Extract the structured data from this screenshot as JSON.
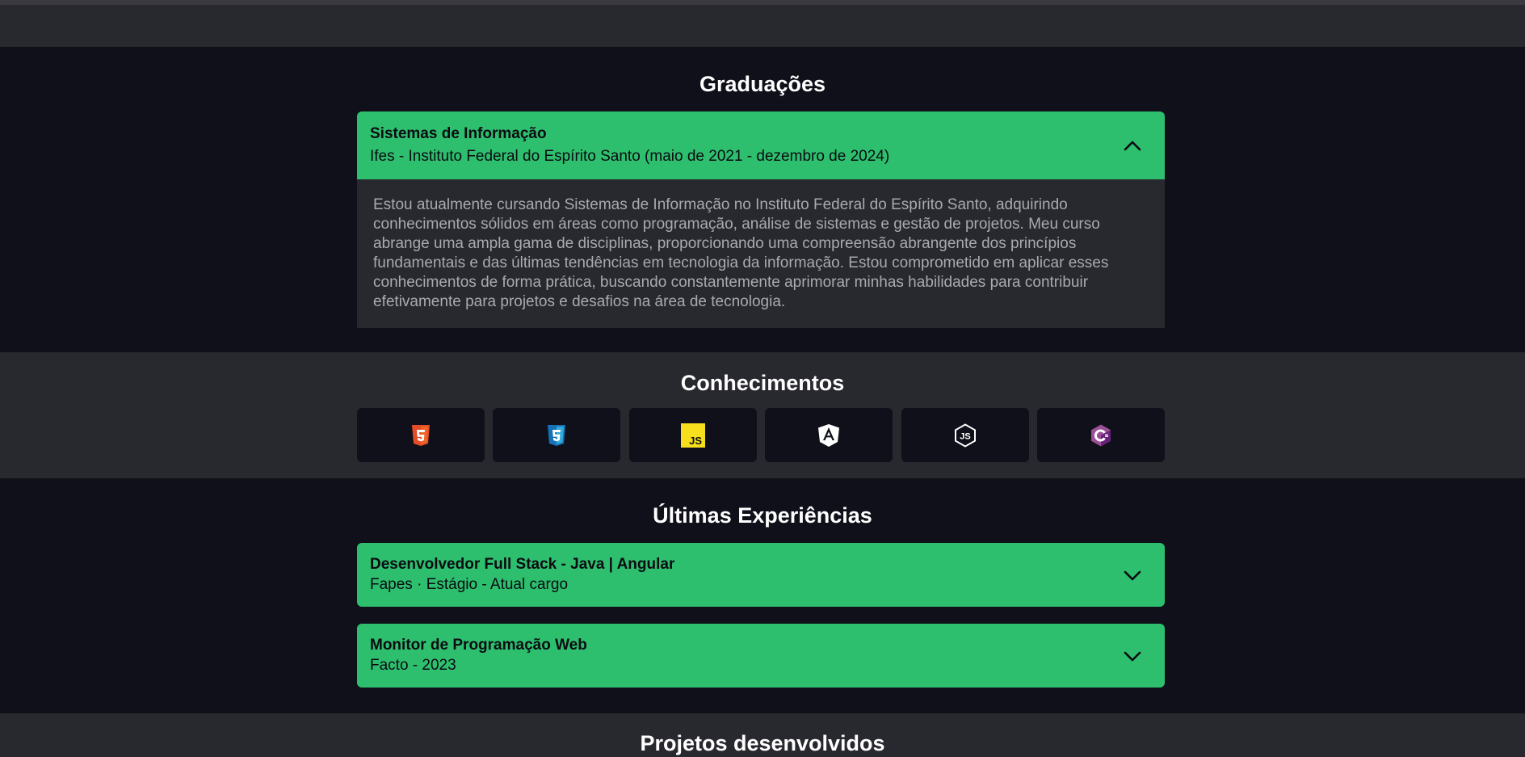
{
  "graduacoes": {
    "title": "Graduações",
    "item": {
      "title": "Sistemas de Informação",
      "subtitle": "Ifes - Instituto Federal do Espírito Santo (maio de 2021 - dezembro de 2024)",
      "expanded": true,
      "body": "Estou atualmente cursando Sistemas de Informação no Instituto Federal do Espírito Santo, adquirindo conhecimentos sólidos em áreas como programação, análise de sistemas e gestão de projetos. Meu curso abrange uma ampla gama de disciplinas, proporcionando uma compreensão abrangente dos princípios fundamentais e das últimas tendências em tecnologia da informação. Estou comprometido em aplicar esses conhecimentos de forma prática, buscando constantemente aprimorar minhas habilidades para contribuir efetivamente para projetos e desafios na área de tecnologia."
    }
  },
  "conhecimentos": {
    "title": "Conhecimentos",
    "skills": [
      {
        "icon": "html5-icon",
        "color": "#e44d26"
      },
      {
        "icon": "css3-icon",
        "color": "#1572b6"
      },
      {
        "icon": "javascript-icon",
        "color": "#f7df1e"
      },
      {
        "icon": "angular-icon",
        "color": "#ffffff"
      },
      {
        "icon": "nodejs-icon",
        "color": "#ffffff"
      },
      {
        "icon": "csharp-icon",
        "color": "#9b4f96"
      }
    ]
  },
  "experiencias": {
    "title": "Últimas Experiências",
    "items": [
      {
        "title": "Desenvolvedor Full Stack - Java | Angular",
        "subtitle": "Fapes · Estágio - Atual cargo",
        "expanded": false
      },
      {
        "title": "Monitor de Programação Web",
        "subtitle": "Facto - 2023",
        "expanded": false
      }
    ]
  },
  "projetos": {
    "title": "Projetos desenvolvidos"
  },
  "colors": {
    "accent": "#2dbf6e",
    "background": "#0f1019",
    "surface": "#28282f"
  }
}
